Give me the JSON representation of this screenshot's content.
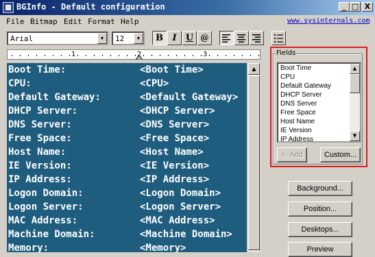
{
  "window": {
    "title": "BGInfo - Default configuration",
    "controls": [
      "_",
      "□",
      "X"
    ]
  },
  "menubar": {
    "items": [
      "File",
      "Bitmap",
      "Edit",
      "Format",
      "Help"
    ],
    "link": "www.sysinternals.com"
  },
  "toolbar": {
    "font": "Arial",
    "size": "12",
    "format_buttons": [
      "B",
      "I",
      "U",
      "@"
    ],
    "align_buttons": [
      "align-left",
      "align-center",
      "align-right",
      "bullet-list"
    ]
  },
  "ruler": {
    "marks": [
      "1",
      "2",
      "3"
    ]
  },
  "editor": {
    "background": "#1f5d7e",
    "rows": [
      {
        "label": "Boot Time:",
        "value": "<Boot Time>"
      },
      {
        "label": "CPU:",
        "value": "<CPU>"
      },
      {
        "label": "Default Gateway:",
        "value": "<Default Gateway>"
      },
      {
        "label": "DHCP Server:",
        "value": "<DHCP Server>"
      },
      {
        "label": "DNS Server:",
        "value": "<DNS Server>"
      },
      {
        "label": "Free Space:",
        "value": "<Free Space>"
      },
      {
        "label": "Host Name:",
        "value": "<Host Name>"
      },
      {
        "label": "IE Version:",
        "value": "<IE Version>"
      },
      {
        "label": "IP Address:",
        "value": "<IP Address>"
      },
      {
        "label": "Logon Domain:",
        "value": "<Logon Domain>"
      },
      {
        "label": "Logon Server:",
        "value": "<Logon Server>"
      },
      {
        "label": "MAC Address:",
        "value": "<MAC Address>"
      },
      {
        "label": "Machine Domain:",
        "value": "<Machine Domain>"
      },
      {
        "label": "Memory:",
        "value": "<Memory>"
      }
    ]
  },
  "fields": {
    "label": "Fields",
    "items": [
      "Boot Time",
      "CPU",
      "Default Gateway",
      "DHCP Server",
      "DNS Server",
      "Free Space",
      "Host Name",
      "IE Version",
      "IP Address"
    ],
    "add_label": "<- Add",
    "custom_label": "Custom..."
  },
  "side_buttons": {
    "background": "Background...",
    "position": "Position...",
    "desktops": "Desktops...",
    "preview": "Preview"
  },
  "colors": {
    "highlight": "#e0161b",
    "titlebar": "#0a246a"
  }
}
